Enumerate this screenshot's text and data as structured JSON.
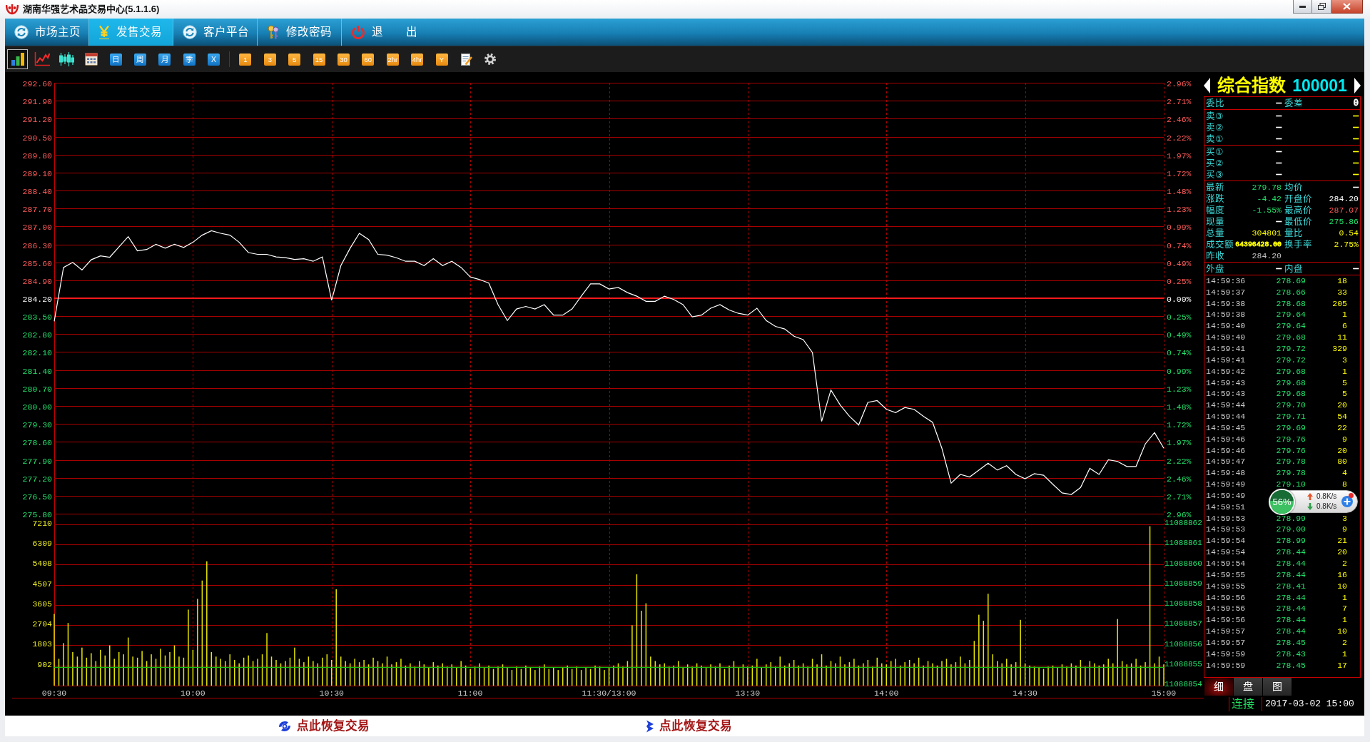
{
  "window": {
    "title": "湖南华强艺术品交易中心(5.1.1.6)"
  },
  "menu": [
    {
      "label": "市场主页",
      "selected": false
    },
    {
      "label": "发售交易",
      "selected": true
    },
    {
      "label": "客户平台",
      "selected": false
    },
    {
      "label": "修改密码",
      "selected": false
    },
    {
      "label": "退　　出",
      "selected": false
    }
  ],
  "toolbar": {
    "view_buttons": [
      {
        "selected": true
      },
      {
        "selected": false
      },
      {
        "selected": false
      },
      {
        "selected": false
      }
    ],
    "period_buttons": [
      {
        "label": "日"
      },
      {
        "label": "周"
      },
      {
        "label": "月"
      },
      {
        "label": "季"
      },
      {
        "label": "X"
      }
    ],
    "interval_buttons": [
      {
        "label": "1"
      },
      {
        "label": "3"
      },
      {
        "label": "5"
      },
      {
        "label": "15"
      },
      {
        "label": "30"
      },
      {
        "label": "60"
      },
      {
        "label": "2hr"
      },
      {
        "label": "4hr"
      },
      {
        "label": "Y"
      }
    ]
  },
  "price_chart": {
    "chart_data": {
      "type": "line",
      "ylim": [
        275.8,
        292.6
      ],
      "yticks": [
        {
          "value": 292.6,
          "label": "292.60"
        },
        {
          "value": 291.9,
          "label": "291.90"
        },
        {
          "value": 291.2,
          "label": "291.20"
        },
        {
          "value": 290.5,
          "label": "290.50"
        },
        {
          "value": 289.8,
          "label": "289.80"
        },
        {
          "value": 289.1,
          "label": "289.10"
        },
        {
          "value": 288.4,
          "label": "288.40"
        },
        {
          "value": 287.7,
          "label": "287.70"
        },
        {
          "value": 287.0,
          "label": "287.00"
        },
        {
          "value": 286.3,
          "label": "286.30"
        },
        {
          "value": 285.6,
          "label": "285.60"
        },
        {
          "value": 284.9,
          "label": "284.90"
        },
        {
          "value": 284.2,
          "label": "284.20"
        },
        {
          "value": 283.5,
          "label": "283.50"
        },
        {
          "value": 282.8,
          "label": "282.80"
        },
        {
          "value": 282.1,
          "label": "282.10"
        },
        {
          "value": 281.4,
          "label": "281.40"
        },
        {
          "value": 280.7,
          "label": "280.70"
        },
        {
          "value": 280.0,
          "label": "280.00"
        },
        {
          "value": 279.3,
          "label": "279.30"
        },
        {
          "value": 278.6,
          "label": "278.60"
        },
        {
          "value": 277.9,
          "label": "277.90"
        },
        {
          "value": 277.2,
          "label": "277.20"
        },
        {
          "value": 276.5,
          "label": "276.50"
        },
        {
          "value": 275.8,
          "label": "275.80"
        }
      ],
      "grid": true,
      "series": [
        {
          "color": "#ffffff",
          "values": [
            283.3,
            285.4,
            285.6,
            285.3,
            285.7,
            285.85,
            285.8,
            286.2,
            286.6,
            286.05,
            286.1,
            286.3,
            286.15,
            286.3,
            286.18,
            286.38,
            286.66,
            286.83,
            286.73,
            286.66,
            286.38,
            285.98,
            285.91,
            285.91,
            285.81,
            285.78,
            285.71,
            285.74,
            285.64,
            285.81,
            284.12,
            285.47,
            286.15,
            286.73,
            286.49,
            285.91,
            285.88,
            285.78,
            285.64,
            285.64,
            285.47,
            285.74,
            285.47,
            285.64,
            285.4,
            285.03,
            284.93,
            284.79,
            283.95,
            283.33,
            283.78,
            283.88,
            283.78,
            283.95,
            283.54,
            283.54,
            283.78,
            284.28,
            284.76,
            284.76,
            284.56,
            284.62,
            284.42,
            284.28,
            284.08,
            284.08,
            284.28,
            284.15,
            283.95,
            283.47,
            283.54,
            283.81,
            283.95,
            283.74,
            283.61,
            283.54,
            283.81,
            283.33,
            283.1,
            283.0,
            282.72,
            282.59,
            282.08,
            279.4,
            280.62,
            280.04,
            279.6,
            279.26,
            280.14,
            280.21,
            279.87,
            279.74,
            279.94,
            279.87,
            279.6,
            279.36,
            278.35,
            276.99,
            277.33,
            277.23,
            277.5,
            277.77,
            277.5,
            277.67,
            277.33,
            277.16,
            277.36,
            277.3,
            276.95,
            276.61,
            276.55,
            276.82,
            277.57,
            277.33,
            277.9,
            277.84,
            277.64,
            277.64,
            278.52,
            278.96,
            278.35
          ]
        }
      ],
      "ref_lines": [
        {
          "axis": "y",
          "value": 284.2
        }
      ]
    },
    "percent_labels": [
      "2.96%",
      "2.71%",
      "2.46%",
      "2.22%",
      "1.97%",
      "1.72%",
      "1.48%",
      "1.23%",
      "0.99%",
      "0.74%",
      "0.49%",
      "0.25%",
      "0.00%",
      "0.25%",
      "0.49%",
      "0.74%",
      "0.99%",
      "1.23%",
      "1.48%",
      "1.72%",
      "1.97%",
      "2.22%",
      "2.46%",
      "2.71%",
      "2.96%"
    ]
  },
  "volume_chart": {
    "chart_data": {
      "type": "bar",
      "categories": [
        "09:30",
        null,
        null,
        null,
        null,
        null,
        null,
        null,
        null,
        null,
        null,
        null,
        null,
        null,
        null,
        null,
        null,
        null,
        null,
        null,
        null,
        null,
        null,
        null,
        null,
        null,
        null,
        null,
        null,
        null,
        "10:00",
        null,
        null,
        null,
        null,
        null,
        null,
        null,
        null,
        null,
        null,
        null,
        null,
        null,
        null,
        null,
        null,
        null,
        null,
        null,
        null,
        null,
        null,
        null,
        null,
        null,
        null,
        null,
        null,
        null,
        "10:30",
        null,
        null,
        null,
        null,
        null,
        null,
        null,
        null,
        null,
        null,
        null,
        null,
        null,
        null,
        null,
        null,
        null,
        null,
        null,
        null,
        null,
        null,
        null,
        null,
        null,
        null,
        null,
        null,
        null,
        "11:00",
        null,
        null,
        null,
        null,
        null,
        null,
        null,
        null,
        null,
        null,
        null,
        null,
        null,
        null,
        null,
        null,
        null,
        null,
        null,
        null,
        null,
        null,
        null,
        null,
        null,
        null,
        null,
        null,
        null,
        "11:30/13:00",
        null,
        null,
        null,
        null,
        null,
        null,
        null,
        null,
        null,
        null,
        null,
        null,
        null,
        null,
        null,
        null,
        null,
        null,
        null,
        null,
        null,
        null,
        null,
        null,
        null,
        null,
        null,
        null,
        null,
        "13:30",
        null,
        null,
        null,
        null,
        null,
        null,
        null,
        null,
        null,
        null,
        null,
        null,
        null,
        null,
        null,
        null,
        null,
        null,
        null,
        null,
        null,
        null,
        null,
        null,
        null,
        null,
        null,
        null,
        null,
        "14:00",
        null,
        null,
        null,
        null,
        null,
        null,
        null,
        null,
        null,
        null,
        null,
        null,
        null,
        null,
        null,
        null,
        null,
        null,
        null,
        null,
        null,
        null,
        null,
        null,
        null,
        null,
        null,
        null,
        null,
        "14:30",
        null,
        null,
        null,
        null,
        null,
        null,
        null,
        null,
        null,
        null,
        null,
        null,
        null,
        null,
        null,
        null,
        null,
        null,
        null,
        null,
        null,
        null,
        null,
        null,
        null,
        null,
        null,
        null,
        null,
        "15:00"
      ],
      "ylim": [
        0,
        7210
      ],
      "yticks": [
        {
          "value": 902,
          "label": "902"
        },
        {
          "value": 1803,
          "label": "1803"
        },
        {
          "value": 2704,
          "label": "2704"
        },
        {
          "value": 3605,
          "label": "3605"
        },
        {
          "value": 4507,
          "label": "4507"
        },
        {
          "value": 5408,
          "label": "5408"
        },
        {
          "value": 6309,
          "label": "6309"
        },
        {
          "value": 7210,
          "label": "7210"
        }
      ],
      "grid": true,
      "series": [
        {
          "color": "#e6e600",
          "values": [
            3210,
            1200,
            1900,
            2800,
            1500,
            1300,
            1700,
            1250,
            1450,
            1100,
            1600,
            1350,
            1800,
            1200,
            1500,
            1400,
            2150,
            1300,
            1250,
            1550,
            1100,
            1400,
            1200,
            1650,
            1350,
            1500,
            1800,
            1300,
            1250,
            3400,
            1600,
            3880,
            4700,
            5560,
            1500,
            1300,
            1200,
            1100,
            1400,
            1150,
            1000,
            1250,
            1350,
            1100,
            1200,
            1400,
            2350,
            1300,
            1150,
            1000,
            1100,
            1250,
            1700,
            1200,
            1050,
            1300,
            1100,
            1000,
            1250,
            1400,
            1150,
            4310,
            1300,
            1100,
            1000,
            1200,
            1050,
            1150,
            950,
            1250,
            1100,
            1000,
            1300,
            950,
            1050,
            1200,
            900,
            1000,
            850,
            1100,
            950,
            800,
            1050,
            900,
            1000,
            850,
            950,
            800,
            1100,
            900,
            750,
            850,
            1000,
            800,
            900,
            750,
            850,
            950,
            800,
            700,
            850,
            750,
            900,
            800,
            700,
            850,
            950,
            750,
            800,
            700,
            800,
            900,
            750,
            850,
            700,
            800,
            750,
            900,
            850,
            700,
            800,
            900,
            1000,
            850,
            1100,
            2700,
            4980,
            3350,
            3680,
            1300,
            1100,
            950,
            1000,
            850,
            900,
            1100,
            800,
            950,
            850,
            1000,
            900,
            800,
            950,
            850,
            1000,
            750,
            900,
            1100,
            800,
            950,
            850,
            900,
            1200,
            800,
            950,
            1050,
            850,
            1300,
            900,
            1000,
            1150,
            900,
            1000,
            850,
            1200,
            950,
            1400,
            900,
            1100,
            1000,
            1300,
            950,
            1050,
            1200,
            900,
            1000,
            1150,
            850,
            1250,
            1000,
            950,
            1100,
            1200,
            900,
            1050,
            1150,
            1000,
            1250,
            900,
            1100,
            1000,
            900,
            1100,
            1200,
            950,
            1050,
            1300,
            1000,
            1150,
            2000,
            3170,
            2900,
            4110,
            1400,
            1100,
            1000,
            1200,
            950,
            1050,
            2940,
            1000,
            900,
            850,
            800,
            750,
            850,
            900,
            800,
            950,
            850,
            1000,
            900,
            1150,
            850,
            1100,
            1000,
            900,
            950,
            1200,
            1000,
            2980,
            1100,
            950,
            1000,
            1200,
            900,
            1050,
            7130,
            1000,
            1300,
            950
          ]
        }
      ],
      "ref_lines": [
        {
          "axis": "y",
          "value": 820
        }
      ]
    },
    "right_labels": [
      "11088862",
      "11088861",
      "11088860",
      "11088859",
      "11088858",
      "11088857",
      "11088856",
      "11088855",
      "11088854"
    ]
  },
  "quote_panel": {
    "title": "综合指数",
    "code": "100001",
    "sections": [
      {
        "rows": [
          {
            "left": {
              "label": "委比",
              "value": "—",
              "color": "#ffffff"
            },
            "right": {
              "label": "委差",
              "value": "0",
              "color": "#ffffff"
            }
          }
        ]
      },
      {
        "rows": [
          {
            "left": {
              "label": "卖③",
              "value": "—",
              "color": "#ffffff"
            },
            "right": {
              "value": "—",
              "color": "#ffff00"
            }
          },
          {
            "left": {
              "label": "卖②",
              "value": "—",
              "color": "#ffffff"
            },
            "right": {
              "value": "—",
              "color": "#ffff00"
            }
          },
          {
            "left": {
              "label": "卖①",
              "value": "—",
              "color": "#ffffff"
            },
            "right": {
              "value": "—",
              "color": "#ffff00"
            }
          }
        ]
      },
      {
        "rows": [
          {
            "left": {
              "label": "买①",
              "value": "—",
              "color": "#ffffff"
            },
            "right": {
              "value": "—",
              "color": "#ffff00"
            }
          },
          {
            "left": {
              "label": "买②",
              "value": "—",
              "color": "#ffffff"
            },
            "right": {
              "value": "—",
              "color": "#ffff00"
            }
          },
          {
            "left": {
              "label": "买③",
              "value": "—",
              "color": "#ffffff"
            },
            "right": {
              "value": "—",
              "color": "#ffff00"
            }
          }
        ]
      },
      {
        "rows": [
          {
            "left": {
              "label": "最新",
              "value": "279.78",
              "color": "#22e06a"
            },
            "right": {
              "label": "均价",
              "value": "—",
              "color": "#ffffff"
            }
          },
          {
            "left": {
              "label": "涨跌",
              "value": "-4.42",
              "color": "#22e06a"
            },
            "right": {
              "label": "开盘价",
              "value": "284.20",
              "color": "#ffffff"
            }
          },
          {
            "left": {
              "label": "幅度",
              "value": "-1.55%",
              "color": "#22e06a"
            },
            "right": {
              "label": "最高价",
              "value": "287.07",
              "color": "#ff5a5a"
            }
          },
          {
            "left": {
              "label": "现量",
              "value": "—",
              "color": "#ffffff"
            },
            "right": {
              "label": "最低价",
              "value": "275.86",
              "color": "#22e06a"
            }
          },
          {
            "left": {
              "label": "总量",
              "value": "304801",
              "color": "#ffff00"
            },
            "right": {
              "label": "量比",
              "value": "0.54",
              "color": "#ffff00"
            }
          },
          {
            "left": {
              "label": "成交额",
              "value": "64396428.00",
              "color": "#ffff00"
            },
            "right": {
              "label": "换手率",
              "value": "2.75%",
              "color": "#ffff00"
            }
          },
          {
            "left": {
              "label": "昨收",
              "value": "284.20",
              "color": "#c0c0c0"
            }
          }
        ]
      },
      {
        "rows": [
          {
            "left": {
              "label": "外盘",
              "value": "—",
              "color": "#ffffff"
            },
            "right": {
              "label": "内盘",
              "value": "—",
              "color": "#ffffff"
            }
          }
        ]
      }
    ],
    "trades": [
      {
        "time": "14:59:36",
        "price": "278.69",
        "volume": "18"
      },
      {
        "time": "14:59:37",
        "price": "278.66",
        "volume": "33"
      },
      {
        "time": "14:59:38",
        "price": "278.68",
        "volume": "205"
      },
      {
        "time": "14:59:38",
        "price": "279.64",
        "volume": "1"
      },
      {
        "time": "14:59:40",
        "price": "279.64",
        "volume": "6"
      },
      {
        "time": "14:59:40",
        "price": "279.68",
        "volume": "11"
      },
      {
        "time": "14:59:41",
        "price": "279.72",
        "volume": "329"
      },
      {
        "time": "14:59:41",
        "price": "279.72",
        "volume": "3"
      },
      {
        "time": "14:59:42",
        "price": "279.68",
        "volume": "1"
      },
      {
        "time": "14:59:43",
        "price": "279.68",
        "volume": "5"
      },
      {
        "time": "14:59:43",
        "price": "279.68",
        "volume": "5"
      },
      {
        "time": "14:59:44",
        "price": "279.70",
        "volume": "20"
      },
      {
        "time": "14:59:44",
        "price": "279.71",
        "volume": "54"
      },
      {
        "time": "14:59:45",
        "price": "279.69",
        "volume": "22"
      },
      {
        "time": "14:59:46",
        "price": "279.76",
        "volume": "9"
      },
      {
        "time": "14:59:46",
        "price": "279.76",
        "volume": "20"
      },
      {
        "time": "14:59:47",
        "price": "279.78",
        "volume": "80"
      },
      {
        "time": "14:59:48",
        "price": "279.78",
        "volume": "4"
      },
      {
        "time": "14:59:49",
        "price": "279.10",
        "volume": "8"
      },
      {
        "time": "14:59:49"
      },
      {
        "time": "14:59:51"
      },
      {
        "time": "14:59:53",
        "price": "278.99",
        "volume": "3"
      },
      {
        "time": "14:59:53",
        "price": "279.00",
        "volume": "9"
      },
      {
        "time": "14:59:54",
        "price": "278.99",
        "volume": "21"
      },
      {
        "time": "14:59:54",
        "price": "278.44",
        "volume": "20"
      },
      {
        "time": "14:59:54",
        "price": "278.44",
        "volume": "2"
      },
      {
        "time": "14:59:55",
        "price": "278.44",
        "volume": "16"
      },
      {
        "time": "14:59:55",
        "price": "278.41",
        "volume": "10"
      },
      {
        "time": "14:59:56",
        "price": "278.44",
        "volume": "1"
      },
      {
        "time": "14:59:56",
        "price": "278.44",
        "volume": "7"
      },
      {
        "time": "14:59:56",
        "price": "278.44",
        "volume": "1"
      },
      {
        "time": "14:59:57",
        "price": "278.44",
        "volume": "10"
      },
      {
        "time": "14:59:57",
        "price": "278.45",
        "volume": "2"
      },
      {
        "time": "14:59:59",
        "price": "278.43",
        "volume": "1"
      },
      {
        "time": "14:59:59",
        "price": "278.45",
        "volume": "17"
      }
    ],
    "tabs": [
      {
        "label": "细",
        "selected": true
      },
      {
        "label": "盘",
        "selected": false
      },
      {
        "label": "图",
        "selected": false
      }
    ],
    "connection": "连接",
    "datetime": "2017-03-02 15:00"
  },
  "speed_widget": {
    "percent": "56%",
    "level": 0.56,
    "upload": "0.8K/s",
    "download": "0.8K/s"
  },
  "status_links": [
    {
      "label": "点此恢复交易"
    },
    {
      "label": "点此恢复交易"
    }
  ]
}
